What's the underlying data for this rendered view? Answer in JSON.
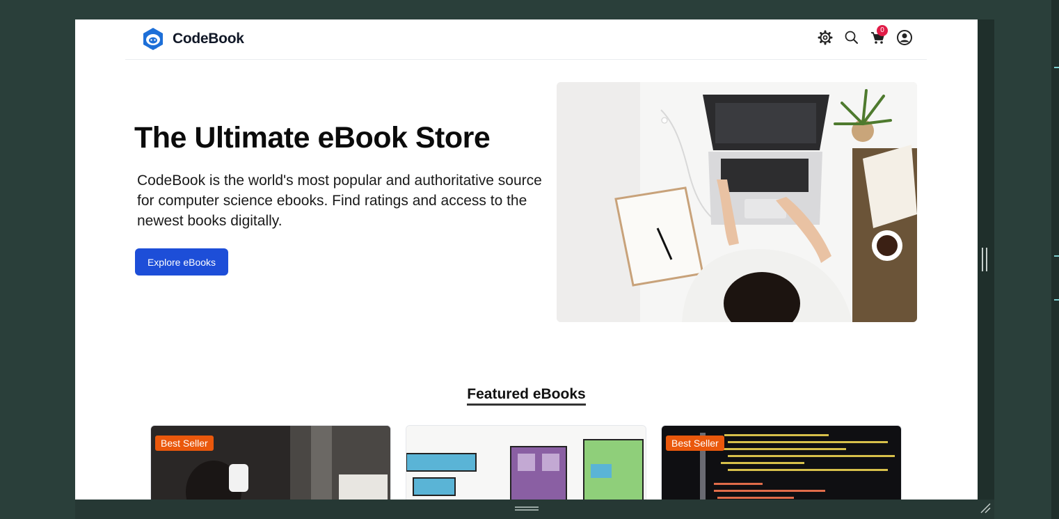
{
  "header": {
    "brand_name": "CodeBook",
    "cart_count": "0",
    "icons": [
      "logo-icon",
      "gear-icon",
      "search-icon",
      "cart-icon",
      "user-icon"
    ]
  },
  "hero": {
    "title": "The Ultimate eBook Store",
    "description": "CodeBook is the world's most popular and authoritative source for computer science ebooks. Find ratings and access to the newest books digitally.",
    "cta_label": "Explore eBooks"
  },
  "featured": {
    "title": "Featured eBooks",
    "cards": [
      {
        "badge": "Best Seller"
      },
      {
        "badge": ""
      },
      {
        "badge": "Best Seller"
      }
    ]
  },
  "colors": {
    "primary": "#1d4ed8",
    "badge": "#ea580c",
    "cart_badge": "#e11d48",
    "frame": "#2a3f3a"
  }
}
